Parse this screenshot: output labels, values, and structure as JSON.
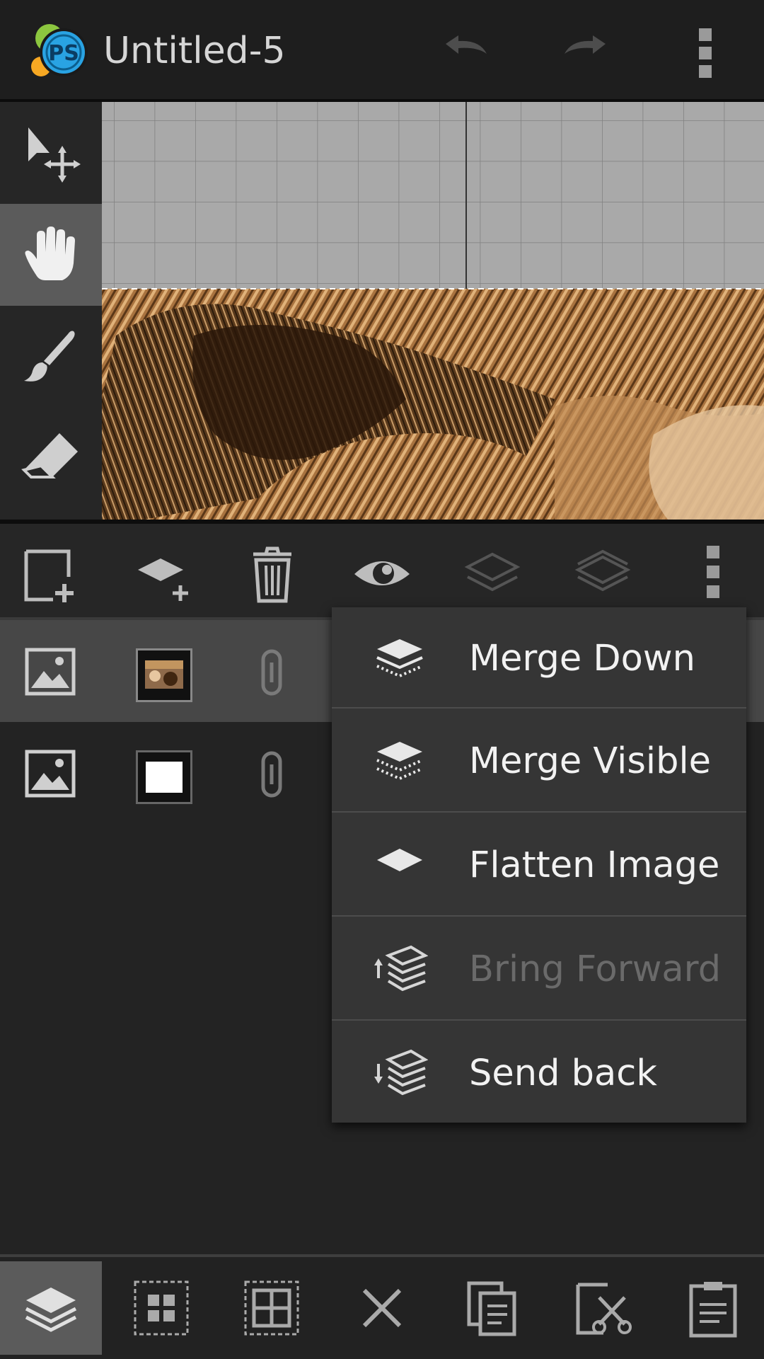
{
  "header": {
    "app_logo_icon": "photoshop-express-logo",
    "title": "Untitled-5",
    "undo_icon": "undo-icon",
    "redo_icon": "redo-icon",
    "overflow_icon": "overflow-menu-icon"
  },
  "tools": [
    {
      "icon": "move-select-icon",
      "active": false
    },
    {
      "icon": "hand-pan-icon",
      "active": true
    },
    {
      "icon": "brush-icon",
      "active": false
    },
    {
      "icon": "eraser-icon",
      "active": false
    }
  ],
  "layer_toolbar": [
    {
      "icon": "new-layer-icon"
    },
    {
      "icon": "add-layer-icon"
    },
    {
      "icon": "delete-layer-icon"
    },
    {
      "icon": "visibility-eye-icon"
    },
    {
      "icon": "layers-stack-icon"
    },
    {
      "icon": "layers-alt-icon"
    },
    {
      "icon": "overflow-menu-icon"
    }
  ],
  "layers": [
    {
      "type_icon": "image-icon",
      "thumbnail": "photo",
      "link_icon": "link-icon",
      "selected": true
    },
    {
      "type_icon": "image-icon",
      "thumbnail": "white",
      "link_icon": "link-icon",
      "selected": false
    }
  ],
  "menu": {
    "items": [
      {
        "label": "Merge Down",
        "icon": "merge-down-icon",
        "enabled": true
      },
      {
        "label": "Merge Visible",
        "icon": "merge-visible-icon",
        "enabled": true
      },
      {
        "label": "Flatten Image",
        "icon": "flatten-image-icon",
        "enabled": true
      },
      {
        "label": "Bring Forward",
        "icon": "bring-forward-icon",
        "enabled": false
      },
      {
        "label": "Send back",
        "icon": "send-back-icon",
        "enabled": true
      }
    ]
  },
  "bottom_bar": [
    {
      "icon": "layers-icon",
      "active": true
    },
    {
      "icon": "select-all-icon",
      "active": false
    },
    {
      "icon": "select-grid-icon",
      "active": false
    },
    {
      "icon": "deselect-x-icon",
      "active": false
    },
    {
      "icon": "copy-icon",
      "active": false
    },
    {
      "icon": "cut-icon",
      "active": false
    },
    {
      "icon": "paste-icon",
      "active": false
    }
  ],
  "colors": {
    "background": "#232323",
    "toolbar": "#1e1e1e",
    "active": "#5b5b5b",
    "menu": "#353535",
    "icon": "#bdbdbd",
    "logo_blue": "#29a3e3",
    "logo_green": "#8cc63f",
    "logo_orange": "#f7a823"
  }
}
